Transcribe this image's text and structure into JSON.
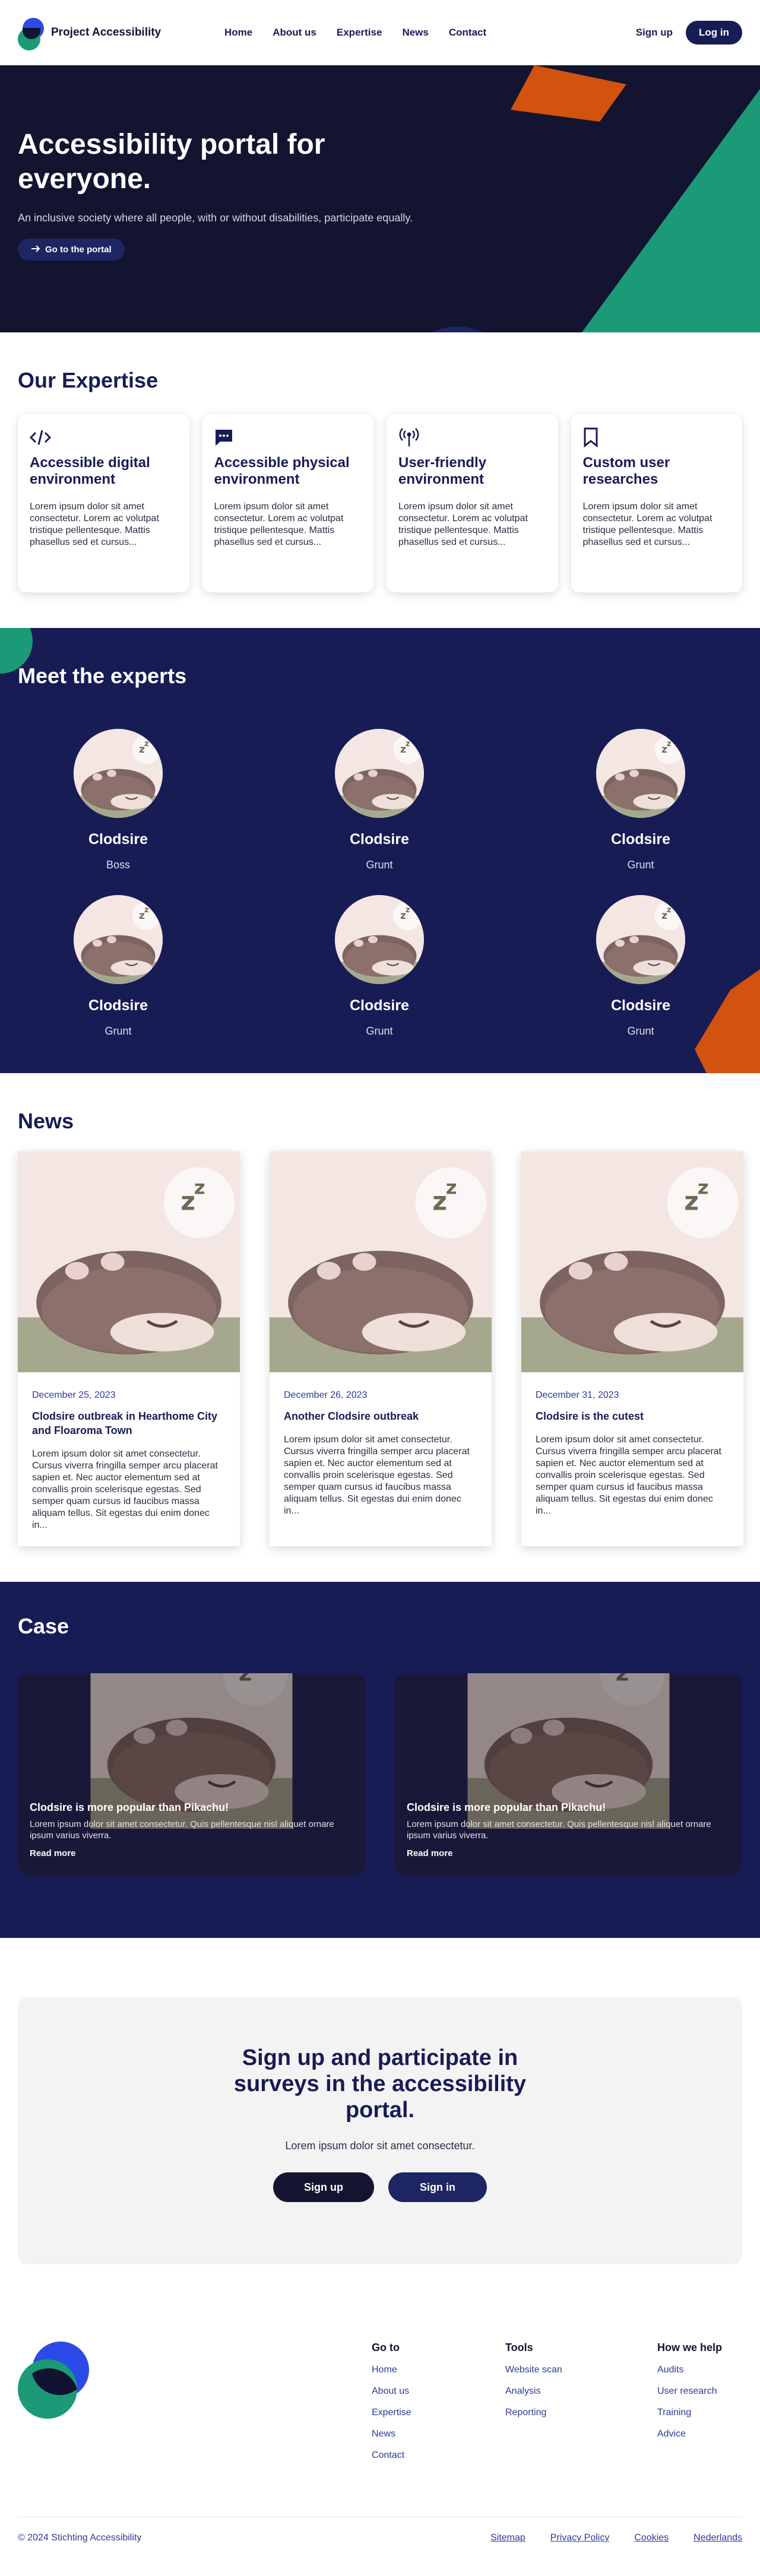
{
  "header": {
    "logo_text": "Project Accessibility",
    "nav": [
      "Home",
      "About us",
      "Expertise",
      "News",
      "Contact"
    ],
    "signup_label": "Sign up",
    "login_label": "Log in"
  },
  "hero": {
    "title": "Accessibility portal for everyone.",
    "subtitle": "An inclusive society where all people, with or without disabilities, participate equally.",
    "cta_label": "Go to the portal",
    "colors": {
      "background": "#121430",
      "orange": "#d2520f",
      "green": "#1c9a78",
      "navy": "#171c55"
    }
  },
  "expertise": {
    "title": "Our Expertise",
    "cards": [
      {
        "icon": "code-icon",
        "title": "Accessible digital environment",
        "text": "Lorem ipsum dolor sit amet consectetur. Lorem ac volutpat tristique pellentesque. Mattis phasellus sed et cursus..."
      },
      {
        "icon": "chat-icon",
        "title": "Accessible physical environment",
        "text": "Lorem ipsum dolor sit amet consectetur. Lorem ac volutpat tristique pellentesque. Mattis phasellus sed et cursus..."
      },
      {
        "icon": "broadcast-icon",
        "title": "User-friendly environment",
        "text": "Lorem ipsum dolor sit amet consectetur. Lorem ac volutpat tristique pellentesque. Mattis phasellus sed et cursus..."
      },
      {
        "icon": "bookmark-icon",
        "title": "Custom user researches",
        "text": "Lorem ipsum dolor sit amet consectetur. Lorem ac volutpat tristique pellentesque. Mattis phasellus sed et cursus..."
      }
    ]
  },
  "experts": {
    "title": "Meet the experts",
    "people": [
      {
        "name": "Clodsire",
        "role": "Boss"
      },
      {
        "name": "Clodsire",
        "role": "Grunt"
      },
      {
        "name": "Clodsire",
        "role": "Grunt"
      },
      {
        "name": "Clodsire",
        "role": "Grunt"
      },
      {
        "name": "Clodsire",
        "role": "Grunt"
      },
      {
        "name": "Clodsire",
        "role": "Grunt"
      }
    ]
  },
  "news": {
    "title": "News",
    "items": [
      {
        "date": "December 25, 2023",
        "title": "Clodsire outbreak in Hearthome City and Floaroma Town",
        "text": "Lorem ipsum dolor sit amet consectetur. Cursus viverra fringilla semper arcu placerat sapien et. Nec auctor elementum sed at convallis proin scelerisque egestas. Sed semper quam cursus id faucibus massa aliquam tellus. Sit egestas dui enim donec in..."
      },
      {
        "date": "December 26, 2023",
        "title": "Another Clodsire outbreak",
        "text": "Lorem ipsum dolor sit amet consectetur. Cursus viverra fringilla semper arcu placerat sapien et. Nec auctor elementum sed at convallis proin scelerisque egestas. Sed semper quam cursus id faucibus massa aliquam tellus. Sit egestas dui enim donec in..."
      },
      {
        "date": "December 31, 2023",
        "title": "Clodsire is the cutest",
        "text": "Lorem ipsum dolor sit amet consectetur. Cursus viverra fringilla semper arcu placerat sapien et. Nec auctor elementum sed at convallis proin scelerisque egestas. Sed semper quam cursus id faucibus massa aliquam tellus. Sit egestas dui enim donec in..."
      }
    ]
  },
  "case": {
    "title": "Case",
    "items": [
      {
        "title": "Clodsire is more popular than Pikachu!",
        "text": "Lorem ipsum dolor sit amet consectetur. Quis pellentesque nisl aliquet ornare ipsum varius viverra.",
        "link": "Read more"
      },
      {
        "title": "Clodsire is more popular than Pikachu!",
        "text": "Lorem ipsum dolor sit amet consectetur. Quis pellentesque nisl aliquet ornare ipsum varius viverra.",
        "link": "Read more"
      }
    ]
  },
  "signup": {
    "title": "Sign up and participate in surveys in the accessibility portal.",
    "text": "Lorem ipsum dolor sit amet consectetur.",
    "signup_label": "Sign up",
    "signin_label": "Sign in"
  },
  "footer": {
    "columns": [
      {
        "title": "Go to",
        "links": [
          "Home",
          "About us",
          "Expertise",
          "News",
          "Contact"
        ]
      },
      {
        "title": "Tools",
        "links": [
          "Website scan",
          "Analysis",
          "Reporting"
        ]
      },
      {
        "title": "How we help",
        "links": [
          "Audits",
          "User research",
          "Training",
          "Advice"
        ]
      }
    ],
    "copyright": "© 2024 Stichting Accessibility",
    "legal": [
      "Sitemap",
      "Privacy Policy",
      "Cookies",
      "Nederlands"
    ]
  }
}
